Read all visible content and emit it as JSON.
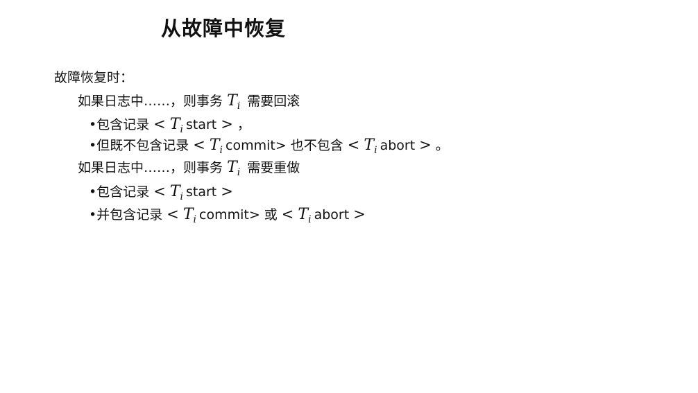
{
  "title": "从故障中恢复",
  "intro": "故障恢复时：",
  "math": {
    "lt": "<",
    "gt": ">",
    "T": "T",
    "i": "i"
  },
  "undo": {
    "heading_pre": "如果日志中……，则事务",
    "heading_post": "需要回滚",
    "bullet1_pre": "•包含记录",
    "bullet1_mid": "start",
    "bullet1_post": "，",
    "bullet2_pre": "•但既不包含记录",
    "bullet2_mid1": "commit> 也不包含",
    "bullet2_mid2": "abort",
    "bullet2_post": "。"
  },
  "redo": {
    "heading_pre": "如果日志中……，则事务",
    "heading_post": "需要重做",
    "bullet1_pre": "•包含记录",
    "bullet1_mid": "start",
    "bullet2_pre": "•并包含记录",
    "bullet2_mid1": "commit> 或",
    "bullet2_mid2": "abort"
  }
}
